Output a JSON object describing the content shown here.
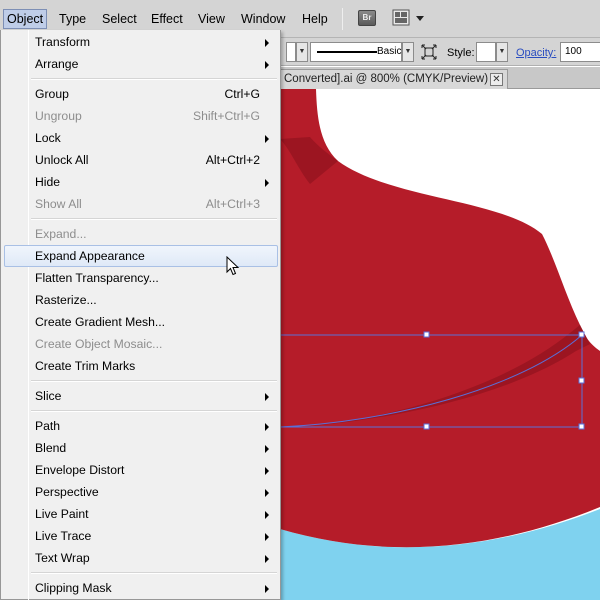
{
  "menubar": {
    "items": [
      "Object",
      "Type",
      "Select",
      "Effect",
      "View",
      "Window",
      "Help"
    ],
    "bridge_label": "Br"
  },
  "control_bar": {
    "stroke_profile": "Basic",
    "style_label": "Style:",
    "opacity_label": "Opacity:",
    "opacity_value": "100"
  },
  "document_tab": {
    "title": "Converted].ai @ 800% (CMYK/Preview)",
    "close": "✕"
  },
  "object_menu": {
    "items": [
      {
        "label": "Transform",
        "shortcut": "",
        "submenu": true,
        "disabled": false
      },
      {
        "label": "Arrange",
        "shortcut": "",
        "submenu": true,
        "disabled": false
      },
      {
        "label": "Group",
        "shortcut": "Ctrl+G",
        "submenu": false,
        "disabled": false
      },
      {
        "label": "Ungroup",
        "shortcut": "Shift+Ctrl+G",
        "submenu": false,
        "disabled": true
      },
      {
        "label": "Lock",
        "shortcut": "",
        "submenu": true,
        "disabled": false
      },
      {
        "label": "Unlock All",
        "shortcut": "Alt+Ctrl+2",
        "submenu": false,
        "disabled": false
      },
      {
        "label": "Hide",
        "shortcut": "",
        "submenu": true,
        "disabled": false
      },
      {
        "label": "Show All",
        "shortcut": "Alt+Ctrl+3",
        "submenu": false,
        "disabled": true
      },
      {
        "label": "Expand...",
        "shortcut": "",
        "submenu": false,
        "disabled": true
      },
      {
        "label": "Expand Appearance",
        "shortcut": "",
        "submenu": false,
        "disabled": false,
        "highlighted": true
      },
      {
        "label": "Flatten Transparency...",
        "shortcut": "",
        "submenu": false,
        "disabled": false
      },
      {
        "label": "Rasterize...",
        "shortcut": "",
        "submenu": false,
        "disabled": false
      },
      {
        "label": "Create Gradient Mesh...",
        "shortcut": "",
        "submenu": false,
        "disabled": false
      },
      {
        "label": "Create Object Mosaic...",
        "shortcut": "",
        "submenu": false,
        "disabled": true
      },
      {
        "label": "Create Trim Marks",
        "shortcut": "",
        "submenu": false,
        "disabled": false
      },
      {
        "label": "Slice",
        "shortcut": "",
        "submenu": true,
        "disabled": false
      },
      {
        "label": "Path",
        "shortcut": "",
        "submenu": true,
        "disabled": false
      },
      {
        "label": "Blend",
        "shortcut": "",
        "submenu": true,
        "disabled": false
      },
      {
        "label": "Envelope Distort",
        "shortcut": "",
        "submenu": true,
        "disabled": false
      },
      {
        "label": "Perspective",
        "shortcut": "",
        "submenu": true,
        "disabled": false
      },
      {
        "label": "Live Paint",
        "shortcut": "",
        "submenu": true,
        "disabled": false
      },
      {
        "label": "Live Trace",
        "shortcut": "",
        "submenu": true,
        "disabled": false
      },
      {
        "label": "Text Wrap",
        "shortcut": "",
        "submenu": true,
        "disabled": false
      },
      {
        "label": "Clipping Mask",
        "shortcut": "",
        "submenu": true,
        "disabled": false
      }
    ]
  },
  "colors": {
    "artwork_red": "#b51c29",
    "artwork_dark_red": "#9c1521",
    "artwork_blue": "#7fd2ef",
    "selection_blue": "#5a6fd8",
    "menu_highlight": "#dfe9f7"
  }
}
